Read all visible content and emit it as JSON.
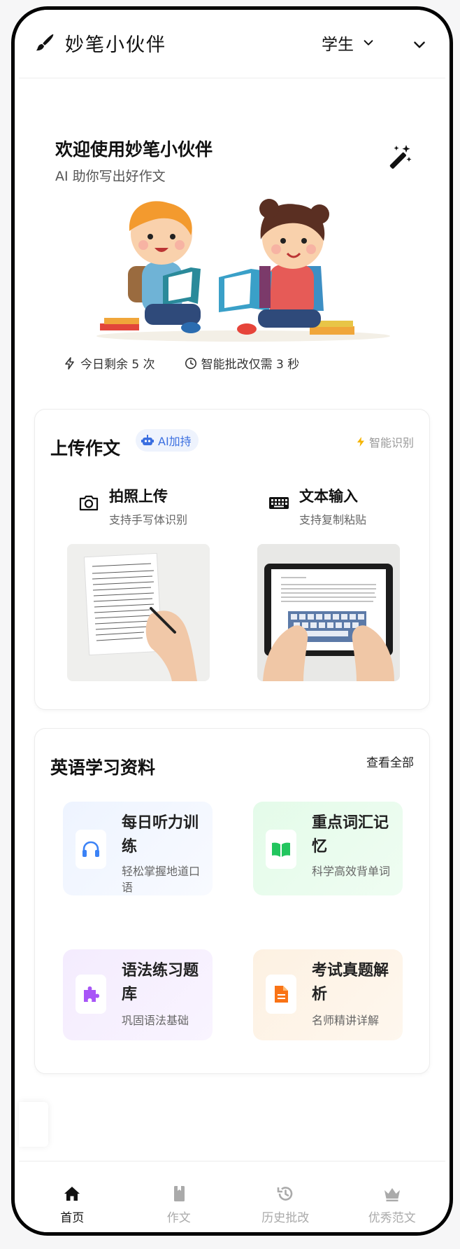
{
  "header": {
    "brand": "妙笔小伙伴",
    "role": "学生",
    "brand_icon": "brush-icon"
  },
  "hero": {
    "title": "欢迎使用妙笔小伙伴",
    "subtitle": "AI 助你写出好作文",
    "stats": [
      {
        "icon": "bolt-icon",
        "text": "今日剩余 5 次"
      },
      {
        "icon": "clock-icon",
        "text": "智能批改仅需 3 秒"
      }
    ]
  },
  "upload": {
    "title": "上传作文",
    "badge": "AI加持",
    "smart": "智能识别",
    "methods": [
      {
        "icon": "camera-icon",
        "title": "拍照上传",
        "desc": "支持手写体识别"
      },
      {
        "icon": "keyboard-icon",
        "title": "文本输入",
        "desc": "支持复制粘贴"
      }
    ]
  },
  "resources": {
    "title": "英语学习资料",
    "view_all": "查看全部",
    "items": [
      {
        "icon": "headphones-icon",
        "title": "每日听力训练",
        "desc": "轻松掌握地道口语",
        "color": "#3b82f6"
      },
      {
        "icon": "book-icon",
        "title": "重点词汇记忆",
        "desc": "科学高效背单词",
        "color": "#22c55e"
      },
      {
        "icon": "puzzle-icon",
        "title": "语法练习题库",
        "desc": "巩固语法基础",
        "color": "#a855f7"
      },
      {
        "icon": "document-icon",
        "title": "考试真题解析",
        "desc": "名师精讲详解",
        "color": "#f97316"
      }
    ]
  },
  "nav": [
    {
      "icon": "home-icon",
      "label": "首页",
      "active": true
    },
    {
      "icon": "book-icon",
      "label": "作文",
      "active": false
    },
    {
      "icon": "history-icon",
      "label": "历史批改",
      "active": false
    },
    {
      "icon": "crown-icon",
      "label": "优秀范文",
      "active": false
    }
  ],
  "colors": {
    "accent_blue": "#3b6fe0",
    "badge_bg": "#eef3fd",
    "smart_bolt": "#f5b400"
  }
}
